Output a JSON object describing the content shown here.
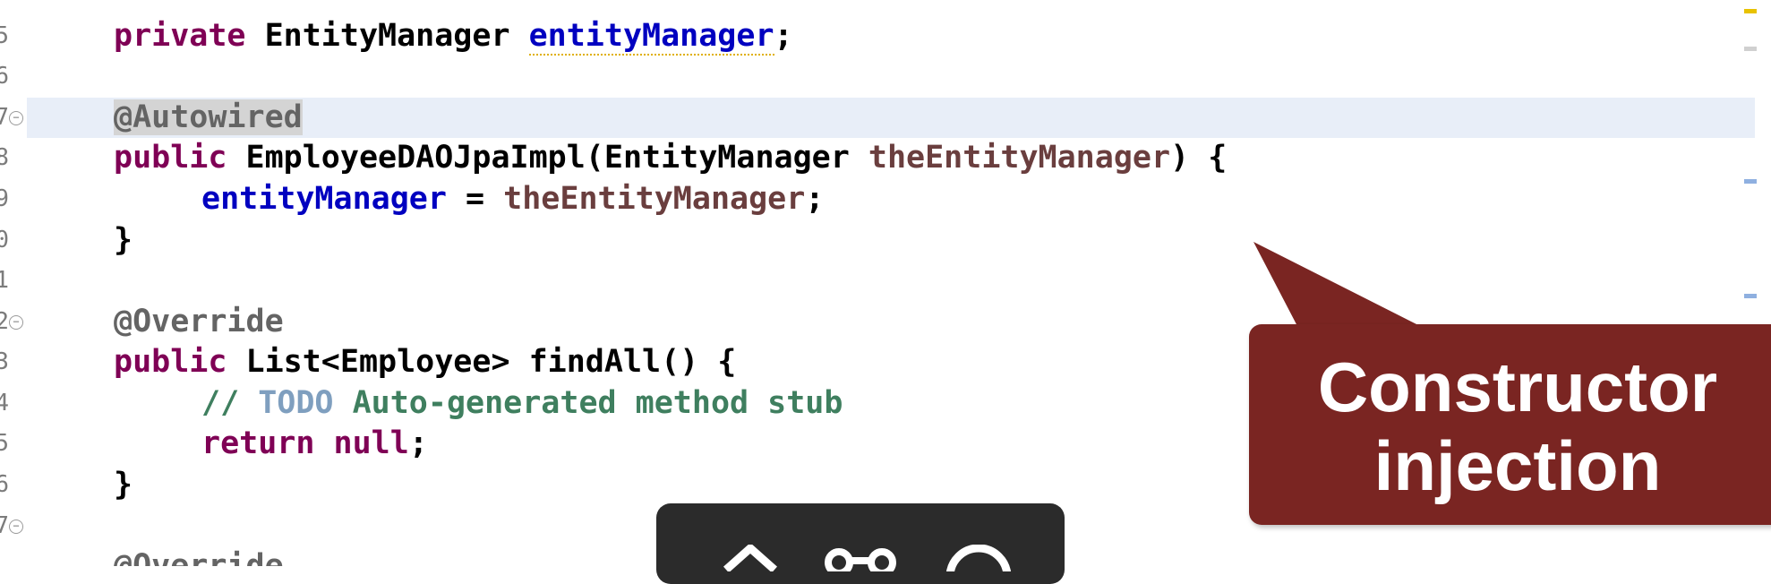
{
  "gutter": {
    "line_numbers": [
      "5",
      "6",
      "7",
      "8",
      "9",
      "0",
      "1",
      "2",
      "3",
      "4",
      "5",
      "6",
      "7"
    ]
  },
  "code": {
    "l1": {
      "kw": "private",
      "type": " EntityManager ",
      "field": "entityManager",
      "end": ";"
    },
    "l2": {
      "ann": "@Autowired"
    },
    "l3": {
      "kw": "public",
      "sig": " EmployeeDAOJpaImpl(EntityManager ",
      "param": "theEntityManager",
      "end": ") {"
    },
    "l4": {
      "field": "entityManager",
      "op": " = ",
      "param": "theEntityManager",
      "end": ";"
    },
    "l5": {
      "text": "}"
    },
    "l6": {
      "ann": "@Override"
    },
    "l7": {
      "kw": "public",
      "sig": " List<Employee> findAll() {"
    },
    "l8": {
      "slashes": "// ",
      "todo": "TODO",
      "rest": " Auto-generated method stub"
    },
    "l9": {
      "kw": "return",
      "sp": " ",
      "kw2": "null",
      "end": ";"
    },
    "l10": {
      "text": "}"
    },
    "l11": {
      "ann": "@Override"
    }
  },
  "callout": {
    "line1": "Constructor",
    "line2": "injection",
    "color": "#7a2522"
  },
  "toolbar": {
    "icons": [
      "up-arrow-icon",
      "command-icon",
      "circle-icon"
    ]
  }
}
